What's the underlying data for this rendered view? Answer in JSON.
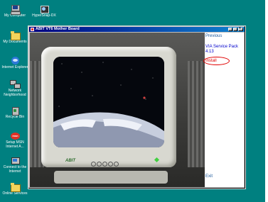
{
  "desktop": {
    "icons": [
      {
        "label": "My Computer"
      },
      {
        "label": "HyperSnap-DX"
      },
      {
        "label": "My Documents"
      },
      {
        "label": "Internet Explorer"
      },
      {
        "label": "Network Neighborhood"
      },
      {
        "label": "Recycle Bin"
      },
      {
        "label": "Setup MSN Internet A..."
      },
      {
        "label": "Connect to the Internet"
      },
      {
        "label": "Online Services"
      }
    ]
  },
  "window": {
    "title": "ABIT VT6 Mother Board",
    "sidebar": {
      "previous": "Previous",
      "item_title_line1": "VIA Service Pack",
      "item_title_line2": "4.13",
      "install": "Install",
      "exit": "Exit"
    },
    "monitor_brand": "ABIT"
  },
  "colors": {
    "desktop": "#008080",
    "title_bar": "#000080",
    "link_blue": "#0000cc",
    "install_red": "#e00000"
  }
}
